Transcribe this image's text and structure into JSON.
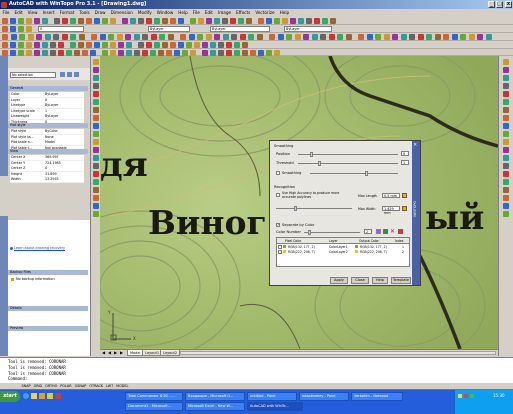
{
  "window": {
    "title": "AutoCAD with WinTopo Pro 3.1 - [Drawing1.dwg]",
    "minimize": "_",
    "maximize": "□",
    "close": "x"
  },
  "menu": [
    "File",
    "Edit",
    "View",
    "Insert",
    "Format",
    "Tools",
    "Draw",
    "Dimension",
    "Modify",
    "Window",
    "Help",
    "File",
    "Edit",
    "Image",
    "Effects",
    "Vectorize",
    "Help"
  ],
  "toolbar": {
    "layer_value": "0",
    "color_value": "ByLayer",
    "linetype_value": "ByLayer",
    "lineweight_value": "ByLayer"
  },
  "properties": {
    "selection": "No selection",
    "section_general": "General",
    "rows": [
      {
        "k": "Color",
        "v": "ByLayer"
      },
      {
        "k": "Layer",
        "v": "0"
      },
      {
        "k": "Linetype",
        "v": "ByLayer"
      },
      {
        "k": "Linetype scale",
        "v": "1"
      },
      {
        "k": "Lineweight",
        "v": "ByLayer"
      },
      {
        "k": "Thickness",
        "v": "0"
      }
    ],
    "section_plot": "Plot style",
    "plot_rows": [
      {
        "k": "Plot style",
        "v": "ByColor"
      },
      {
        "k": "Plot style ta...",
        "v": "None"
      },
      {
        "k": "Plot table a...",
        "v": "Model"
      },
      {
        "k": "Plot table t...",
        "v": "Not available"
      }
    ],
    "section_view": "View",
    "view_rows": [
      {
        "k": "Center X",
        "v": "369.997"
      },
      {
        "k": "Center Y",
        "v": "724.1985"
      },
      {
        "k": "Center Z",
        "v": "0"
      },
      {
        "k": "Height",
        "v": "31.899"
      },
      {
        "k": "Width",
        "v": "13.2955"
      }
    ],
    "recovery_link": "Learn about drawing recovery",
    "backup_header": "Backup Files",
    "backup_text": "No backup information",
    "details_header": "Details",
    "preview_header": "Preview"
  },
  "canvas": {
    "map_letters": [
      "дя",
      "Виног",
      "ый"
    ],
    "ucs_y": "Y",
    "ucs_x": "X"
  },
  "dialog": {
    "section_smoothing": "Smoothing",
    "position_label": "Position",
    "position_value": "0",
    "threshold_label": "Threshold",
    "threshold_value": "1",
    "smoothing_label": "Smoothing",
    "section_recognition": "Recognition",
    "high_accuracy_label": "Use High Accuracy to produce more accurate polylines",
    "max_length_label": "Max Length",
    "max_length_value": "0.5 mm",
    "max_width_label": "Max Width",
    "max_width_value": "1.429 mm",
    "separate_color_label": "Separate by Color",
    "color_number_label": "Color Number",
    "color_number_value": "2",
    "table_headers": [
      "Pixel Color",
      "Layer",
      "Output Color",
      "Index"
    ],
    "table_rows": [
      {
        "pixel": "RGB(132, 177, 2)",
        "layer": "ColorLayer1",
        "output": "RGB(132, 177, 2)",
        "index": "1"
      },
      {
        "pixel": "RGB(222, 206, 7)",
        "layer": "ColorLayer2",
        "output": "RGB(222, 206, 7)",
        "index": "2"
      }
    ],
    "buttons": {
      "apply": "Apply",
      "close": "Close",
      "help": "Help",
      "template": "Template"
    },
    "side_title": "WINTOPO"
  },
  "layout_tabs": [
    "Model",
    "Layout1",
    "Layout2"
  ],
  "command_lines": [
    "Tool is removed: CORONAR",
    "Tool is removed: CORONAR",
    "Tool is removed: CORONAR",
    "Command:"
  ],
  "status_items": [
    "SNAP",
    "GRID",
    "ORTHO",
    "POLAR",
    "OSNAP",
    "OTRACK",
    "LWT",
    "MODEL"
  ],
  "taskbar": {
    "start": "start",
    "tasks": [
      "Total Commander 6.50 - ...",
      "Входящие - Microsoft O...",
      "untitled - Paint",
      "adaptivekey - Paint",
      "Document1 - Microsoft...",
      "Microsoft Excel - New W...",
      "Verbatim - Notepad",
      "AutoCAD with WinTo..."
    ],
    "time": "15:30"
  }
}
